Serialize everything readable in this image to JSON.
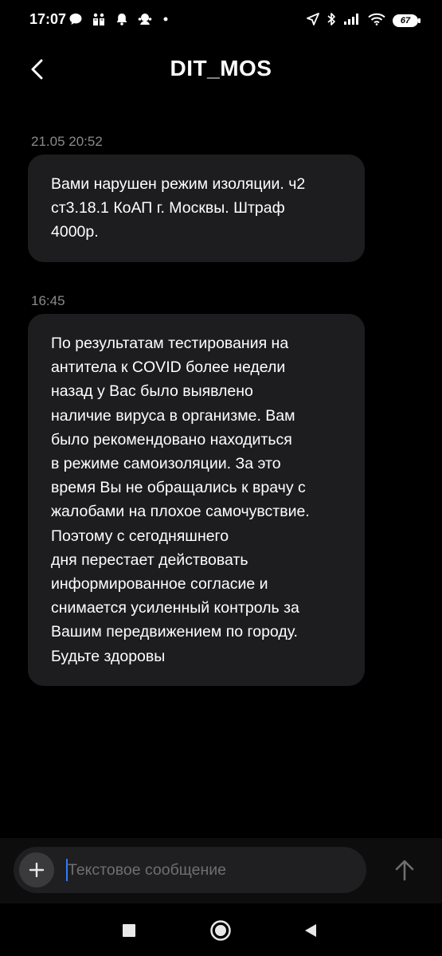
{
  "status_bar": {
    "time": "17:07",
    "battery": "67",
    "icons_left": [
      "chat-bubble-icon",
      "app-notification-icon",
      "bell-icon",
      "app-badge-icon",
      "more-dots-icon"
    ],
    "icons_right": [
      "location-arrow-icon",
      "bluetooth-icon",
      "cellular-signal-icon",
      "wifi-icon",
      "battery-icon"
    ]
  },
  "header": {
    "title": "DIT_MOS",
    "back_icon": "chevron-left-icon"
  },
  "messages": [
    {
      "timestamp": "21.05 20:52",
      "lines": [
        "Вами нарушен режим изоляции. ч2",
        "ст3.18.1 КоАП г. Москвы. Штраф",
        "4000р."
      ]
    },
    {
      "timestamp": "16:45",
      "lines": [
        "По результатам тестирования на",
        "антитела к COVID более недели",
        "назад у Вас было выявлено",
        "наличие вируса в организме. Вам",
        "было рекомендовано находиться",
        "в режиме самоизоляции. За это",
        "время Вы не обращались к врачу с",
        "жалобами на плохое самочувствие.",
        "Поэтому с сегодняшнего",
        "дня перестает действовать",
        "информированное согласие и",
        "снимается усиленный контроль за",
        "Вашим передвижением по городу.",
        "Будьте здоровы"
      ]
    }
  ],
  "compose": {
    "placeholder": "Текстовое сообщение",
    "value": "",
    "attach_icon": "plus-icon",
    "send_icon": "arrow-up-icon"
  },
  "nav": {
    "icons": [
      "square-recents-icon",
      "circle-home-icon",
      "triangle-back-icon"
    ]
  },
  "colors": {
    "background": "#000000",
    "bubble": "#1d1d1f",
    "timestamp": "#8a8a8a",
    "caret": "#2f7cf6"
  }
}
